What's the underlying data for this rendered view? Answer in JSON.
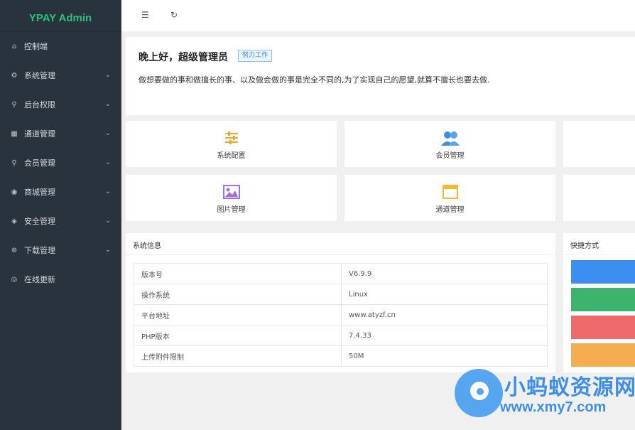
{
  "sidebar": {
    "logo": "YPAY Admin",
    "items": [
      {
        "label": "控制端",
        "icon": "home-icon",
        "expandable": false
      },
      {
        "label": "系统管理",
        "icon": "gear-icon",
        "expandable": true
      },
      {
        "label": "后台权限",
        "icon": "user-icon",
        "expandable": true
      },
      {
        "label": "通道管理",
        "icon": "channel-icon",
        "expandable": true
      },
      {
        "label": "会员管理",
        "icon": "user-icon",
        "expandable": true
      },
      {
        "label": "商城管理",
        "icon": "shop-icon",
        "expandable": true
      },
      {
        "label": "安全管理",
        "icon": "diamond-icon",
        "expandable": true
      },
      {
        "label": "下载管理",
        "icon": "download-icon",
        "expandable": true
      },
      {
        "label": "在线更新",
        "icon": "shield-check-icon",
        "expandable": false
      }
    ]
  },
  "topbar": {
    "menu_icon": "menu-fold-icon",
    "refresh_icon": "refresh-icon"
  },
  "welcome": {
    "greeting": "晚上好，超级管理员",
    "badge": "努力工作",
    "motto": "做想要做的事和做擅长的事、以及做会做的事是完全不同的,为了实现自己的愿望,就算不擅长也要去做."
  },
  "shortcut_cards": [
    {
      "label": "系统配置",
      "icon": "sliders-icon",
      "color": "#f5a623"
    },
    {
      "label": "会员管理",
      "icon": "users-icon",
      "color": "#3d8ee8"
    },
    {
      "label": "图片管理",
      "icon": "image-icon",
      "color": "#a56ee0"
    },
    {
      "label": "通道管理",
      "icon": "window-icon",
      "color": "#f5b833"
    }
  ],
  "system_info": {
    "title": "系统信息",
    "rows": [
      {
        "key": "版本号",
        "value": "V6.9.9"
      },
      {
        "key": "操作系统",
        "value": "Linux"
      },
      {
        "key": "平台地址",
        "value": "www.atyzf.cn"
      },
      {
        "key": "PHP版本",
        "value": "7.4.33"
      },
      {
        "key": "上传附件限制",
        "value": "50M"
      }
    ]
  },
  "quick_access": {
    "title": "快捷方式",
    "colors": [
      "#3b8ff0",
      "#3cb46e",
      "#ef6a6a",
      "#f5ad51"
    ]
  },
  "watermark": {
    "title": "小蚂蚁资源网",
    "url": "www.xmy7.com"
  }
}
